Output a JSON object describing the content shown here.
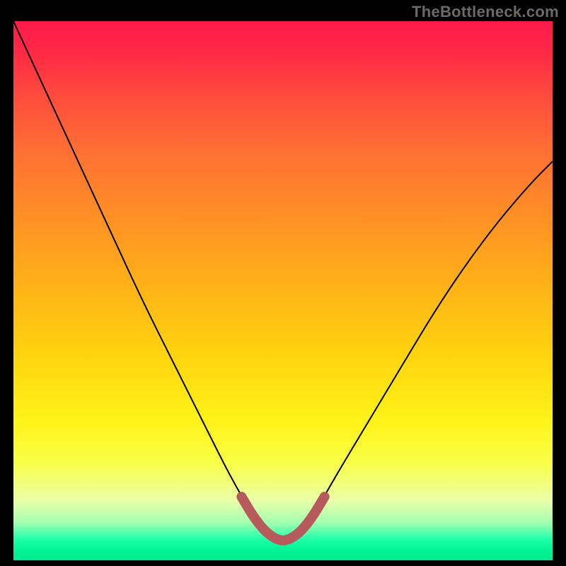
{
  "watermark": "TheBottleneck.com",
  "chart_data": {
    "type": "line",
    "title": "",
    "xlabel": "",
    "ylabel": "",
    "xlim": [
      0,
      100
    ],
    "ylim": [
      0,
      100
    ],
    "grid": false,
    "legend": false,
    "series": [
      {
        "name": "main-curve",
        "color": "#000000",
        "x": [
          0,
          6,
          12,
          18,
          24,
          30,
          36,
          40,
          44,
          47.5,
          52.5,
          56,
          60,
          66,
          72,
          78,
          84,
          90,
          96,
          100
        ],
        "values": [
          100,
          87,
          74,
          61,
          48,
          36,
          24,
          16,
          9,
          4,
          4,
          9,
          16,
          26,
          36,
          46,
          55,
          63,
          70,
          74
        ]
      },
      {
        "name": "highlight-segment",
        "color": "#b65a5c",
        "x": [
          42.3,
          44.2,
          46.1,
          48,
          50,
          52,
          53.9,
          55.8,
          57.7
        ],
        "values": [
          11.8,
          8.6,
          6.0,
          4.3,
          3.5,
          4.3,
          6.0,
          8.6,
          11.8
        ]
      }
    ],
    "annotations": [
      "TheBottleneck.com"
    ]
  },
  "colors": {
    "page_bg": "#000000",
    "gradient_top": "#ff1a4c",
    "gradient_mid": "#ffe540",
    "gradient_bottom": "#00e98e",
    "curve": "#000000",
    "highlight": "#b65a5c",
    "watermark": "#6a6a6a"
  }
}
